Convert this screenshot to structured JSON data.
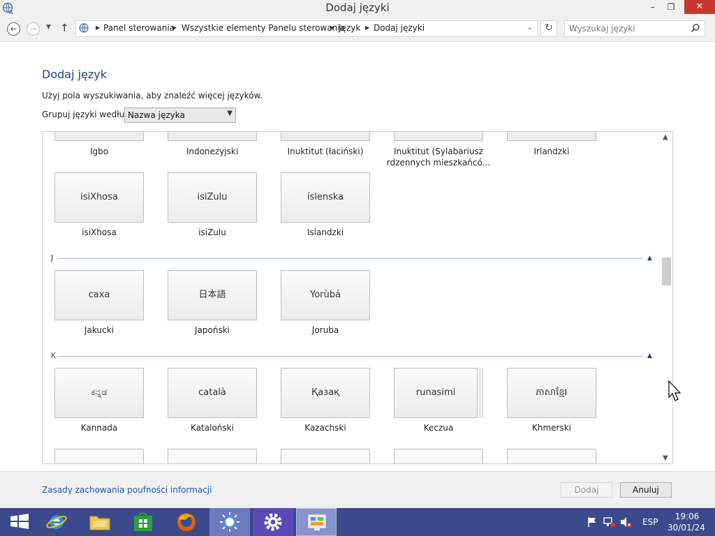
{
  "window": {
    "title": "Dodaj języki"
  },
  "titlebar": {
    "min": "–",
    "max": "❐",
    "close": "✕"
  },
  "nav": {
    "breadcrumbs": [
      "Panel sterowania",
      "Wszystkie elementy Panelu sterowania",
      "Język",
      "Dodaj języki"
    ],
    "search_placeholder": "Wyszukaj języki"
  },
  "content": {
    "heading": "Dodaj język",
    "hint": "Użyj pola wyszukiwania, aby znaleźć więcej języków.",
    "group_label": "Grupuj języki według:",
    "group_value": "Nazwa języka"
  },
  "list": {
    "top_row_captions": [
      "Igbo",
      "Indonezyjski",
      "Inuktitut (łaciński)",
      "Inuktitut (Sylabariusz rdzennych mieszkańcó...",
      "Irlandzki"
    ],
    "i_row2": [
      {
        "native": "isiXhosa",
        "name": "isiXhosa"
      },
      {
        "native": "isiZulu",
        "name": "isiZulu"
      },
      {
        "native": "íslenska",
        "name": "Islandzki"
      }
    ],
    "group_j": "J",
    "j_row": [
      {
        "native": "саха",
        "name": "Jakucki"
      },
      {
        "native": "日本語",
        "name": "Japoński"
      },
      {
        "native": "Yorùbá",
        "name": "Joruba"
      }
    ],
    "group_k": "K",
    "k_row": [
      {
        "native": "ಕನ್ನಡ",
        "name": "Kannada"
      },
      {
        "native": "català",
        "name": "Kataloński"
      },
      {
        "native": "Қазақ",
        "name": "Kazachski"
      },
      {
        "native": "runasimi",
        "name": "Keczua"
      },
      {
        "native": "ភាសាខ្មែរ",
        "name": "Khmerski"
      }
    ]
  },
  "footer": {
    "privacy": "Zasady zachowania poufności informacji",
    "add": "Dodaj",
    "cancel": "Anuluj"
  },
  "taskbar": {
    "lang": "ESP",
    "time": "19:06",
    "date": "30/01/24"
  }
}
